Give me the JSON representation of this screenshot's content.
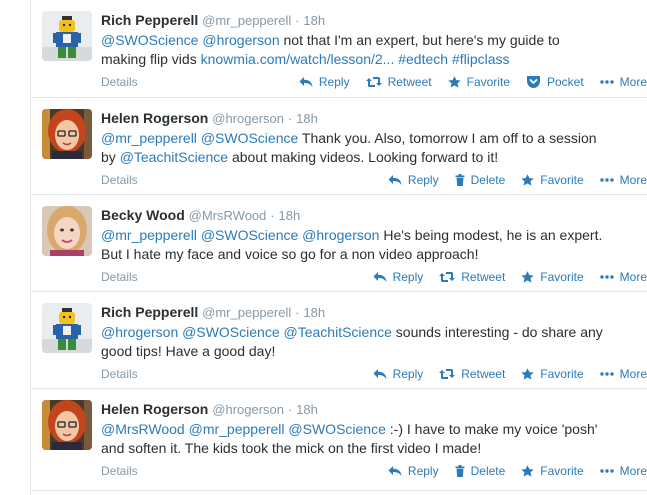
{
  "tweets": [
    {
      "fullname": "Rich Pepperell",
      "username": "@mr_pepperell",
      "time": "18h",
      "lines": [
        [
          {
            "t": "@SWOScience",
            "link": true
          },
          {
            "t": " ",
            "link": false
          },
          {
            "t": "@hrogerson",
            "link": true
          },
          {
            "t": " not that I'm an expert, but here's my guide to",
            "link": false
          }
        ],
        [
          {
            "t": "making flip vids ",
            "link": false
          },
          {
            "t": "knowmia.com/watch/lesson/2...",
            "link": true
          },
          {
            "t": " ",
            "link": false
          },
          {
            "t": "#edtech",
            "link": true
          },
          {
            "t": " ",
            "link": false
          },
          {
            "t": "#flipclass",
            "link": true
          }
        ]
      ],
      "details": "Details",
      "actions": [
        {
          "name": "reply",
          "label": "Reply",
          "icon": "reply-icon"
        },
        {
          "name": "retweet",
          "label": "Retweet",
          "icon": "retweet-icon"
        },
        {
          "name": "favorite",
          "label": "Favorite",
          "icon": "star-icon"
        },
        {
          "name": "pocket",
          "label": "Pocket",
          "icon": "pocket-icon"
        },
        {
          "name": "more",
          "label": "More",
          "icon": "more-icon"
        }
      ],
      "avatar": "lego-avatar"
    },
    {
      "fullname": "Helen Rogerson",
      "username": "@hrogerson",
      "time": "18h",
      "lines": [
        [
          {
            "t": "@mr_pepperell",
            "link": true
          },
          {
            "t": " ",
            "link": false
          },
          {
            "t": "@SWOScience",
            "link": true
          },
          {
            "t": " Thank you. Also, tomorrow I am off to a session",
            "link": false
          }
        ],
        [
          {
            "t": "by ",
            "link": false
          },
          {
            "t": "@TeachitScience",
            "link": true
          },
          {
            "t": " about making videos. Looking forward to it!",
            "link": false
          }
        ]
      ],
      "details": "Details",
      "actions": [
        {
          "name": "reply",
          "label": "Reply",
          "icon": "reply-icon"
        },
        {
          "name": "delete",
          "label": "Delete",
          "icon": "trash-icon"
        },
        {
          "name": "favorite",
          "label": "Favorite",
          "icon": "star-icon"
        },
        {
          "name": "more",
          "label": "More",
          "icon": "more-icon"
        }
      ],
      "avatar": "redhead-avatar"
    },
    {
      "fullname": "Becky Wood",
      "username": "@MrsRWood",
      "time": "18h",
      "lines": [
        [
          {
            "t": "@mr_pepperell",
            "link": true
          },
          {
            "t": " ",
            "link": false
          },
          {
            "t": "@SWOScience",
            "link": true
          },
          {
            "t": " ",
            "link": false
          },
          {
            "t": "@hrogerson",
            "link": true
          },
          {
            "t": " He's being modest, he is an expert.",
            "link": false
          }
        ],
        [
          {
            "t": "But I hate my face and voice so go for a non video approach!",
            "link": false
          }
        ]
      ],
      "details": "Details",
      "actions": [
        {
          "name": "reply",
          "label": "Reply",
          "icon": "reply-icon"
        },
        {
          "name": "retweet",
          "label": "Retweet",
          "icon": "retweet-icon"
        },
        {
          "name": "favorite",
          "label": "Favorite",
          "icon": "star-icon"
        },
        {
          "name": "more",
          "label": "More",
          "icon": "more-icon"
        }
      ],
      "avatar": "blonde-avatar"
    },
    {
      "fullname": "Rich Pepperell",
      "username": "@mr_pepperell",
      "time": "18h",
      "lines": [
        [
          {
            "t": "@hrogerson",
            "link": true
          },
          {
            "t": " ",
            "link": false
          },
          {
            "t": "@SWOScience",
            "link": true
          },
          {
            "t": " ",
            "link": false
          },
          {
            "t": "@TeachitScience",
            "link": true
          },
          {
            "t": " sounds interesting - do share any",
            "link": false
          }
        ],
        [
          {
            "t": "good tips! Have a good day!",
            "link": false
          }
        ]
      ],
      "details": "Details",
      "actions": [
        {
          "name": "reply",
          "label": "Reply",
          "icon": "reply-icon"
        },
        {
          "name": "retweet",
          "label": "Retweet",
          "icon": "retweet-icon"
        },
        {
          "name": "favorite",
          "label": "Favorite",
          "icon": "star-icon"
        },
        {
          "name": "more",
          "label": "More",
          "icon": "more-icon"
        }
      ],
      "avatar": "lego-avatar"
    },
    {
      "fullname": "Helen Rogerson",
      "username": "@hrogerson",
      "time": "18h",
      "lines": [
        [
          {
            "t": "@MrsRWood",
            "link": true
          },
          {
            "t": " ",
            "link": false
          },
          {
            "t": "@mr_pepperell",
            "link": true
          },
          {
            "t": " ",
            "link": false
          },
          {
            "t": "@SWOScience",
            "link": true
          },
          {
            "t": " :-) I have to make my voice 'posh'",
            "link": false
          }
        ],
        [
          {
            "t": "and soften it. The kids took the mick on the first video I made!",
            "link": false
          }
        ]
      ],
      "details": "Details",
      "actions": [
        {
          "name": "reply",
          "label": "Reply",
          "icon": "reply-icon"
        },
        {
          "name": "delete",
          "label": "Delete",
          "icon": "trash-icon"
        },
        {
          "name": "favorite",
          "label": "Favorite",
          "icon": "star-icon"
        },
        {
          "name": "more",
          "label": "More",
          "icon": "more-icon"
        }
      ],
      "avatar": "redhead-avatar"
    }
  ],
  "separator": "·",
  "colors": {
    "link": "#2b7bb9",
    "muted": "#8899a6",
    "text": "#292f33",
    "border": "#e1e8ed"
  }
}
